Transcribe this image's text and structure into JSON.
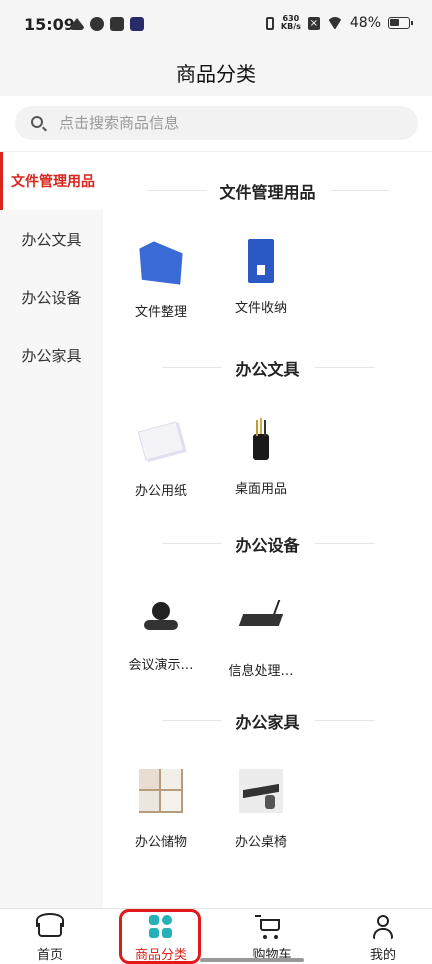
{
  "status_bar": {
    "time": "15:09",
    "speed_value": "630",
    "speed_unit": "KB/s",
    "battery": "48%"
  },
  "header": {
    "title": "商品分类"
  },
  "search": {
    "placeholder": "点击搜索商品信息"
  },
  "sidebar": {
    "items": [
      {
        "label": "文件管理用品",
        "active": true
      },
      {
        "label": "办公文具",
        "active": false
      },
      {
        "label": "办公设备",
        "active": false
      },
      {
        "label": "办公家具",
        "active": false
      }
    ]
  },
  "sections": [
    {
      "title": "文件管理用品",
      "products": [
        {
          "label": "文件整理",
          "icon": "file-organizer-image"
        },
        {
          "label": "文件收纳",
          "icon": "file-folder-image"
        }
      ]
    },
    {
      "title": "办公文具",
      "products": [
        {
          "label": "办公用纸",
          "icon": "paper-image"
        },
        {
          "label": "桌面用品",
          "icon": "pen-holder-image"
        }
      ]
    },
    {
      "title": "办公设备",
      "products": [
        {
          "label": "会议演示…",
          "icon": "conference-camera-image"
        },
        {
          "label": "信息处理…",
          "icon": "router-image"
        }
      ]
    },
    {
      "title": "办公家具",
      "products": [
        {
          "label": "办公储物",
          "icon": "storage-boxes-image"
        },
        {
          "label": "办公桌椅",
          "icon": "desk-chair-image"
        }
      ]
    }
  ],
  "tabbar": {
    "tabs": [
      {
        "label": "首页",
        "icon": "home-icon"
      },
      {
        "label": "商品分类",
        "icon": "category-icon",
        "active": true
      },
      {
        "label": "购物车",
        "icon": "cart-icon"
      },
      {
        "label": "我的",
        "icon": "user-icon"
      }
    ]
  },
  "colors": {
    "accent": "#d8261d",
    "category_icon": "#26b1b9",
    "highlight": "#e01a1a"
  }
}
